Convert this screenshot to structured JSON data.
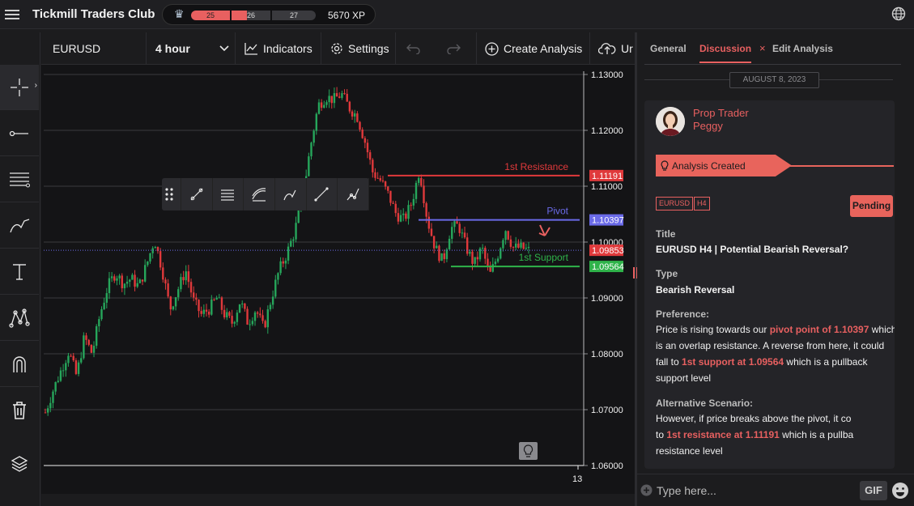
{
  "app": {
    "title": "Tickmill Traders Club",
    "xp_levels": [
      "25",
      "26",
      "27"
    ],
    "xp": "5670 XP",
    "level_progress": 0.4
  },
  "toolbar": {
    "symbol": "EURUSD",
    "interval": "4 hour",
    "indicators": "Indicators",
    "settings": "Settings",
    "create_analysis": "Create Analysis",
    "upload_partial": "Ur"
  },
  "left_tools": [
    "crosshair-icon",
    "horizontal-ray-icon",
    "fib-levels-icon",
    "brush-icon",
    "text-icon",
    "pattern-icon",
    "magnet-icon",
    "trash-icon",
    "layers-icon"
  ],
  "draw_tools": [
    "drag-handle-icon",
    "trend-line-icon",
    "channel-icon",
    "fib-retracement-icon",
    "brush-icon",
    "line-icon",
    "path-icon"
  ],
  "chart_data": {
    "type": "candlestick",
    "symbol": "EURUSD",
    "interval": "4 hour",
    "y_ticks": [
      "1.13000",
      "1.12000",
      "1.11000",
      "1.10000",
      "1.09000",
      "1.08000",
      "1.07000",
      "1.06000"
    ],
    "ylim": [
      1.06,
      1.13
    ],
    "x_tick": "13",
    "levels": [
      {
        "name": "1st Resistance",
        "value": 1.11191,
        "label": "1.11191",
        "color": "#e0393b"
      },
      {
        "name": "Pivot",
        "value": 1.10397,
        "label": "1.10397",
        "color": "#6a6ae8"
      },
      {
        "name": "1st Support",
        "value": 1.09564,
        "label": "1.09564",
        "color": "#2fb34a"
      }
    ],
    "current_price": {
      "value": 1.09853,
      "label": "1.09853",
      "color": "#e0393b"
    },
    "price_path": [
      1.0695,
      1.0735,
      1.077,
      1.0805,
      1.076,
      1.083,
      1.08,
      1.087,
      1.092,
      1.0945,
      1.0925,
      1.0935,
      1.092,
      1.096,
      1.1005,
      1.095,
      1.088,
      1.0915,
      1.095,
      1.0895,
      1.087,
      1.088,
      1.09,
      1.087,
      1.0855,
      1.0895,
      1.0855,
      1.088,
      1.0845,
      1.09,
      1.095,
      1.098,
      1.102,
      1.108,
      1.117,
      1.1245,
      1.126,
      1.1255,
      1.1265,
      1.124,
      1.1225,
      1.118,
      1.1125,
      1.111,
      1.1085,
      1.105,
      1.104,
      1.107,
      1.113,
      1.104,
      1.099,
      1.0965,
      1.1025,
      1.103,
      1.099,
      1.096,
      1.099,
      1.094,
      1.0975,
      1.1025,
      1.099,
      1.099,
      1.0985
    ]
  },
  "panel": {
    "tabs": [
      "General",
      "Discussion",
      "Edit Analysis"
    ],
    "tab_close": "×",
    "date": "AUGUST 8, 2023",
    "author_role": "Prop Trader",
    "author_name": "Peggy",
    "created": "Analysis Created",
    "tags": [
      "EURUSD",
      "H4"
    ],
    "status": "Pending",
    "title_label": "Title",
    "title": "EURUSD H4 | Potential Bearish Reversal?",
    "type_label": "Type",
    "type": "Bearish Reversal",
    "pref_label": "Preference:",
    "pref_1": "Price is rising towards our ",
    "pref_hl_1": "pivot point of 1.10397",
    "pref_2": " which is an overlap resistance. A reverse from here, it could fall to ",
    "pref_hl_2": "1st support at 1.09564",
    "pref_3": " which is a pullback support level",
    "alt_label": "Alternative Scenario:",
    "alt_1": "However, if price breaks above the pivot, it co",
    "alt_2": "to ",
    "alt_hl": "1st resistance at 1.11191",
    "alt_3": " which is a pullba",
    "alt_4": "resistance level",
    "input_placeholder": "Type here...",
    "gif": "GIF"
  }
}
